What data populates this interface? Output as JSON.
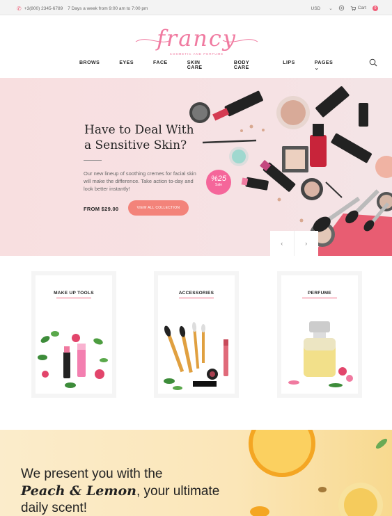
{
  "topbar": {
    "phone": "+3(800) 2345-6789",
    "hours": "7 Days a week from 9:00 am to 7:00 pm",
    "currency": "USD",
    "cart_label": "Cart",
    "cart_count": "0"
  },
  "header": {
    "logo": "francy",
    "tagline": "COSMETIC AND PERFUME",
    "nav": [
      "BROWS",
      "EYES",
      "FACE",
      "SKIN CARE",
      "BODY CARE",
      "LIPS",
      "PAGES"
    ]
  },
  "hero": {
    "title_line1": "Have to Deal With",
    "title_line2": "a Sensitive Skin?",
    "text": "Our new lineup of soothing cremes for facial skin will make the difference. Take action to-day and look better instantly!",
    "price": "FROM $29.00",
    "button": "VIEW ALL COLLECTION",
    "badge_top": "%25",
    "badge_bottom": "Sale",
    "prev": "‹",
    "next": "›"
  },
  "categories": [
    {
      "title": "MAKE UP TOOLS"
    },
    {
      "title": "ACCESSORIES"
    },
    {
      "title": "PERFUME"
    }
  ],
  "promo": {
    "line1": "We present you with the",
    "line2_em": "Peach & Lemon",
    "line2_rest": ", your ultimate",
    "line3": "daily scent!"
  },
  "colors": {
    "accent": "#f0607a",
    "cta": "#f3837a",
    "hero_bg": "#f8dfe0"
  }
}
